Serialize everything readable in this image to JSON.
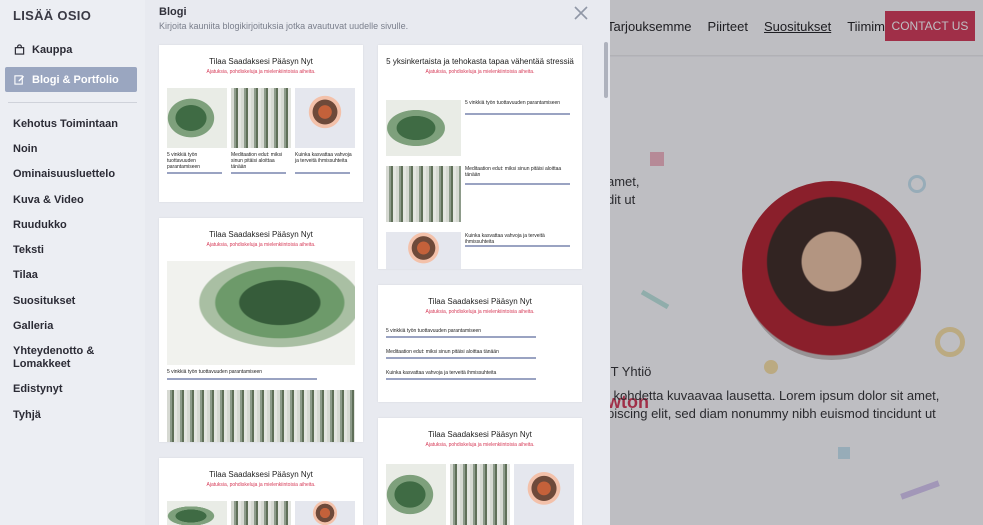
{
  "site": {
    "nav": [
      "Tarjouksemme",
      "Piirteet",
      "Suositukset",
      "Tiimimme"
    ],
    "nav_active": "Suositukset",
    "cta": "CONTACT US",
    "hero_line1": "amet,",
    "hero_line2": "dit ut",
    "name": "wton",
    "company": "IT Yhtiö",
    "desc1": "i kohdetta kuvaavaa lausetta. Lorem ipsum dolor sit amet,",
    "desc2": "piscing elit, sed diam nonummy nibh euismod tincidunt ut",
    "accent": "#d63a57"
  },
  "sidebar": {
    "title": "LISÄÄ OSIO",
    "top_items": [
      {
        "label": "Kauppa",
        "icon": "shopping-bag-icon"
      },
      {
        "label": "Blogi & Portfolio",
        "icon": "edit-icon",
        "active": true
      }
    ],
    "items": [
      "Kehotus Toimintaan",
      "Noin",
      "Ominaisuusluettelo",
      "Kuva & Video",
      "Ruudukko",
      "Teksti",
      "Tilaa",
      "Suositukset",
      "Galleria",
      "Yhteydenotto & Lomakkeet",
      "Edistynyt",
      "Tyhjä"
    ]
  },
  "panel": {
    "title": "Blogi",
    "subtitle": "Kirjoita kauniita blogikirjoituksia jotka avautuvat uudelle sivulle.",
    "cards": [
      {
        "title": "Tilaa Saadaksesi Pääsyn Nyt",
        "subtitle": "Ajatuksia, pohdiskeluja ja mielenkiintoisia aiheita."
      },
      {
        "title": "5 yksinkertaista ja tehokasta tapaa vähentää stressiä",
        "subtitle": "Ajatuksia, pohdiskeluja ja mielenkiintoisia aiheita."
      },
      {
        "title": "Tilaa Saadaksesi Pääsyn Nyt",
        "subtitle": "Ajatuksia, pohdiskeluja ja mielenkiintoisia aiheita."
      },
      {
        "title": "Tilaa Saadaksesi Pääsyn Nyt",
        "subtitle": "Ajatuksia, pohdiskeluja ja mielenkiintoisia aiheita."
      },
      {
        "title": "Tilaa Saadaksesi Pääsyn Nyt",
        "subtitle": "Ajatuksia, pohdiskeluja ja mielenkiintoisia aiheita."
      },
      {
        "title": "Tilaa Saadaksesi Pääsyn Nyt",
        "subtitle": "Ajatuksia, pohdiskeluja ja mielenkiintoisia aiheita."
      }
    ],
    "posts": [
      "5 vinkkiä työn tuottavuuden parantamiseen",
      "Meditaation edut: miksi sinun pitäisi aloittaa tänään",
      "Kuinka kasvattaa vahvoja ja terveitä ihmissuhteita"
    ]
  }
}
